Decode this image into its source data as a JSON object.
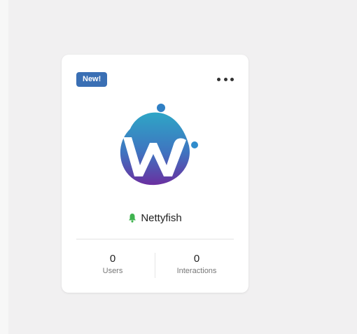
{
  "colors": {
    "badge": "#3a6fb4",
    "logo_top": "#2ea6c6",
    "logo_bottom": "#6a2fa0",
    "bell": "#3fb34f"
  },
  "card": {
    "badge": "New!",
    "more_icon": "more-horizontal-icon",
    "name_icon": "bell-icon",
    "name": "Nettyfish",
    "stats": [
      {
        "value": "0",
        "label": "Users"
      },
      {
        "value": "0",
        "label": "Interactions"
      }
    ]
  }
}
